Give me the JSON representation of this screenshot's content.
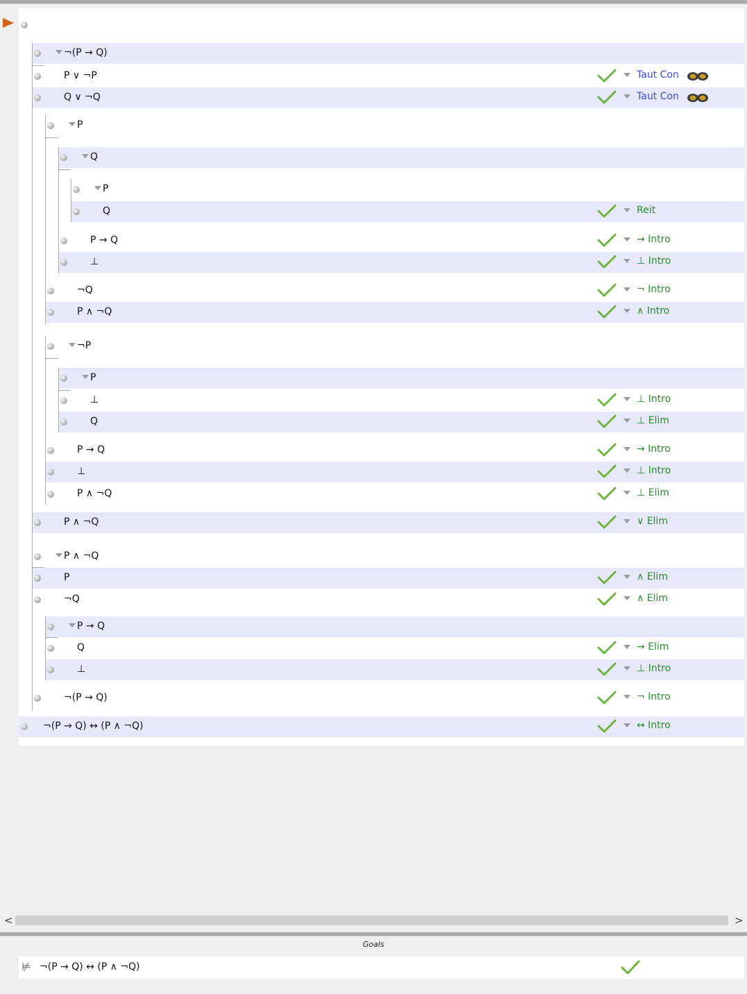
{
  "goals": {
    "title": "Goals",
    "items": [
      {
        "turnstile": "⊭",
        "formula": "¬(P → Q) ↔ (P ∧ ¬Q)",
        "status": "check-icon"
      }
    ]
  },
  "proof": {
    "steps": [
      {
        "formula": "",
        "rule": ""
      },
      {
        "formula": "¬(P → Q)",
        "rule": "",
        "assumption": true
      },
      {
        "formula": "P ∨ ¬P",
        "rule": "Taut Con"
      },
      {
        "formula": "Q ∨ ¬Q",
        "rule": "Taut Con"
      },
      {
        "formula": "P",
        "rule": "",
        "assumption": true
      },
      {
        "formula": "Q",
        "rule": "",
        "assumption": true
      },
      {
        "formula": "P",
        "rule": "",
        "assumption": true
      },
      {
        "formula": "Q",
        "rule": "Reit"
      },
      {
        "formula": "P → Q",
        "rule": "→ Intro"
      },
      {
        "formula": "⊥",
        "rule": "⊥ Intro"
      },
      {
        "formula": "¬Q",
        "rule": "¬ Intro"
      },
      {
        "formula": "P ∧ ¬Q",
        "rule": "∧ Intro"
      },
      {
        "formula": "¬P",
        "rule": "",
        "assumption": true
      },
      {
        "formula": "P",
        "rule": "",
        "assumption": true
      },
      {
        "formula": "⊥",
        "rule": "⊥ Intro"
      },
      {
        "formula": "Q",
        "rule": "⊥ Elim"
      },
      {
        "formula": "P → Q",
        "rule": "→ Intro"
      },
      {
        "formula": "⊥",
        "rule": "⊥ Intro"
      },
      {
        "formula": "P ∧ ¬Q",
        "rule": "⊥ Elim"
      },
      {
        "formula": "P ∧ ¬Q",
        "rule": "∨ Elim"
      },
      {
        "formula": "P ∧ ¬Q",
        "rule": "",
        "assumption": true
      },
      {
        "formula": "P",
        "rule": "∧ Elim"
      },
      {
        "formula": "¬Q",
        "rule": "∧ Elim"
      },
      {
        "formula": "P → Q",
        "rule": "",
        "assumption": true
      },
      {
        "formula": "Q",
        "rule": "→ Elim"
      },
      {
        "formula": "⊥",
        "rule": "⊥ Intro"
      },
      {
        "formula": "¬(P → Q)",
        "rule": "¬ Intro"
      },
      {
        "formula": "¬(P → Q) ↔ (P ∧ ¬Q)",
        "rule": "↔ Intro"
      }
    ]
  },
  "colors": {
    "check": "#6cb33f",
    "rule_green": "#2d8a2d",
    "rule_blue": "#3a4fd0",
    "row_alt": "#e8e8fb",
    "pointer": "#d4621c"
  },
  "scrollbar": {
    "left": "<",
    "right": ">"
  }
}
